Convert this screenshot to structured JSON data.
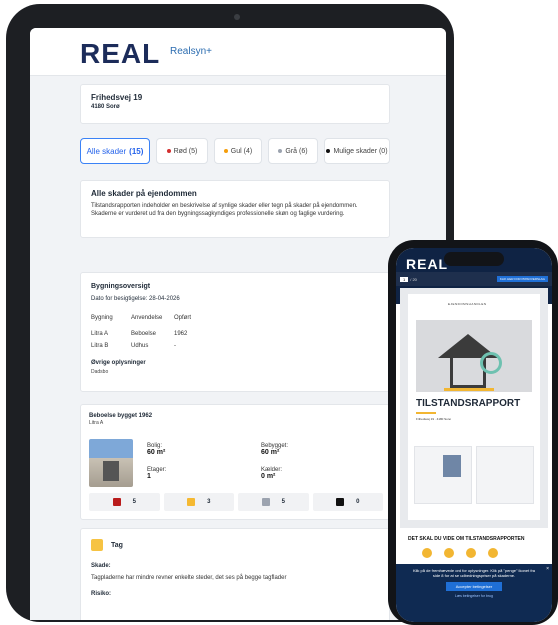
{
  "tablet": {
    "logo": "REAL",
    "product": "Realsyn+",
    "address": {
      "line1": "Frihedsvej 19",
      "line2": "4180 Sorø"
    },
    "filters": [
      {
        "label": "Alle skader",
        "count": "(15)",
        "active": true
      },
      {
        "label": "Rød (5)",
        "color": "#d32f2f"
      },
      {
        "label": "Gul (4)",
        "color": "#f59e0b"
      },
      {
        "label": "Grå (6)",
        "color": "#9ca3af"
      },
      {
        "label": "Mulige skader (0)",
        "color": "#111111"
      }
    ],
    "intro": {
      "title": "Alle skader på ejendommen",
      "text": "Tilstandsrapporten indeholder en beskrivelse af synlige skader eller tegn på skader på ejendommen. Skaderne er vurderet ud fra den bygningssagkyndiges professionelle skøn og faglige vurdering."
    },
    "overview": {
      "title": "Bygningsoversigt",
      "date": "Dato for besigtigelse: 28-04-2026",
      "columns": [
        "Bygning",
        "Anvendelse",
        "Opført"
      ],
      "rows": [
        [
          "Litra A",
          "Beboelse",
          "1962"
        ],
        [
          "Litra B",
          "Udhus",
          "-"
        ]
      ],
      "other_label": "Øvrige oplysninger",
      "other_value": "Dadsbo"
    },
    "building": {
      "title": "Beboelse bygget 1962",
      "sub": "Litra A",
      "bolig_label": "Bolig:",
      "bolig_value": "60 m²",
      "bebygget_label": "Bebygget:",
      "bebygget_value": "60 m²",
      "etager_label": "Etager:",
      "etager_value": "1",
      "kaelder_label": "Kælder:",
      "kaelder_value": "0 m²",
      "counts": [
        {
          "value": "5",
          "color": "#b91c1c"
        },
        {
          "value": "3",
          "color": "#f5b932"
        },
        {
          "value": "5",
          "color": "#9ca3af"
        },
        {
          "value": "0",
          "color": "#111111"
        }
      ]
    },
    "roof": {
      "title": "Tag",
      "skade_label": "Skade:",
      "skade_text": "Tagpladerne har mindre revner enkelte steder, det ses på begge tagflader",
      "risiko_label": "Risiko:"
    }
  },
  "phone": {
    "logo": "REAL",
    "page_current": "1",
    "page_total": "/ 20",
    "cta": "KLIK HER FOR PRISOVERSLAG",
    "brand": "EJENDOMSHANDLEN",
    "report_title": "TILSTANDSRAPPORT",
    "meta": "Frihedsvej 19 · 4180 Sorø",
    "section_title": "DET SKAL DU VIDE OM TILSTANDSRAPPORTEN",
    "cookie_text": "Klik på de fremhævede ord for oplysninger. Klik på \"penge\" ikonet fra side 8 for at se udbedningspriser på skaderne.",
    "accept": "Accepter betingelser",
    "terms": "Læs betingelser for brug",
    "close": "×"
  }
}
